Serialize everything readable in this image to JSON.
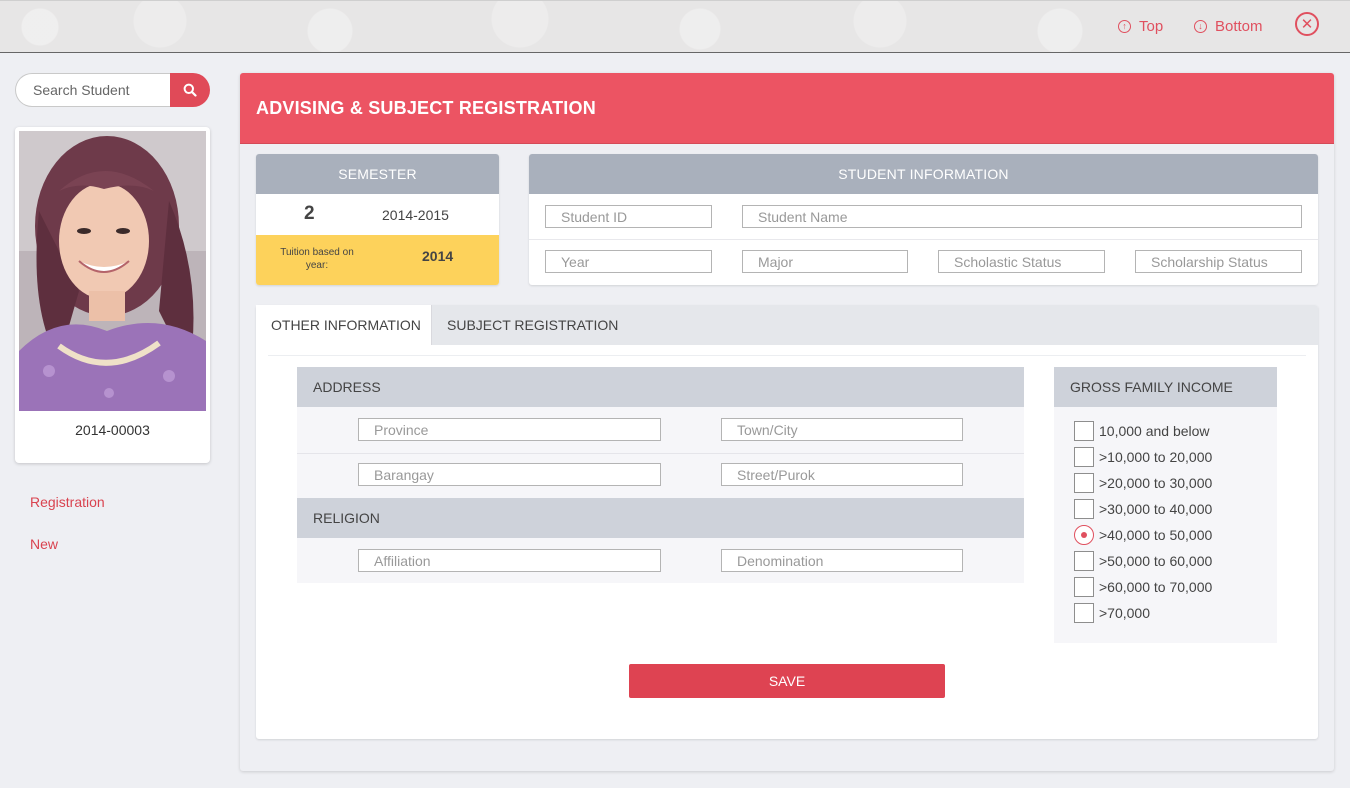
{
  "topbar": {
    "top_label": "Top",
    "bottom_label": "Bottom",
    "top_icon": "arrow-up-circle-icon",
    "bottom_icon": "arrow-down-circle-icon",
    "close_icon": "close-circle-icon"
  },
  "sidebar": {
    "search_placeholder": "Search Student",
    "search_icon": "search-icon",
    "student_number": "2014-00003",
    "links": [
      "Registration",
      "New"
    ]
  },
  "main": {
    "title": "ADVISING & SUBJECT REGISTRATION",
    "semester": {
      "header": "SEMESTER",
      "number": "2",
      "school_year": "2014-2015",
      "tuition_label": "Tuition based on year:",
      "tuition_year": "2014"
    },
    "student_info": {
      "header": "STUDENT INFORMATION",
      "fields": {
        "student_id": "Student ID",
        "student_name": "Student Name",
        "year": "Year",
        "major": "Major",
        "scholastic_status": "Scholastic Status",
        "scholarship_status": "Scholarship Status"
      }
    },
    "tabs": [
      {
        "label": "OTHER INFORMATION",
        "active": true
      },
      {
        "label": "SUBJECT REGISTRATION",
        "active": false
      }
    ],
    "address": {
      "header": "ADDRESS",
      "province": "Province",
      "town_city": "Town/City",
      "barangay": "Barangay",
      "street_purok": "Street/Purok"
    },
    "religion": {
      "header": "RELIGION",
      "affiliation": "Affiliation",
      "denomination": "Denomination"
    },
    "income": {
      "header": "GROSS FAMILY INCOME",
      "options": [
        "10,000 and below",
        ">10,000 to 20,000",
        ">20,000 to 30,000",
        ">30,000 to 40,000",
        ">40,000 to 50,000",
        ">50,000 to 60,000",
        ">60,000 to 70,000",
        ">70,000"
      ],
      "selected": ">40,000 to 50,000"
    },
    "save_label": "SAVE"
  },
  "colors": {
    "accent": "#ec5463",
    "button": "#de4352",
    "tuition_bg": "#fdd25b",
    "card_header": "#a9b0bc",
    "section_header": "#ced2da"
  }
}
